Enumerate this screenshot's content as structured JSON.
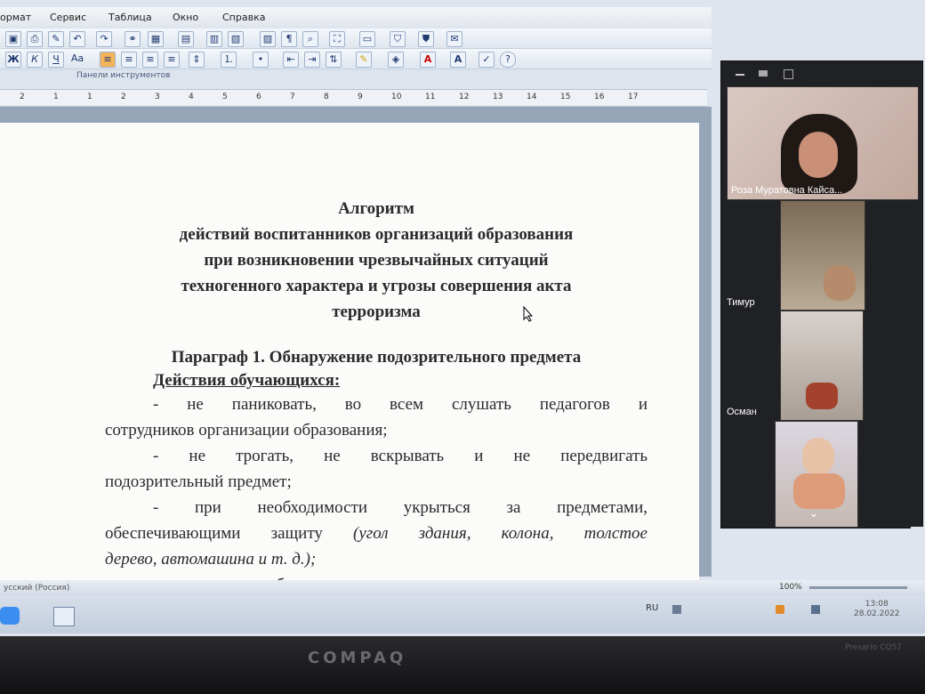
{
  "menu": {
    "items": [
      "ормат",
      "Сервис",
      "Таблица",
      "Окно",
      "Справка"
    ]
  },
  "toolbar": {
    "panel_label": "Панели инструментов",
    "font_size_hint": "Aa"
  },
  "ruler": {
    "numbers": [
      "2",
      "1",
      "1",
      "2",
      "3",
      "4",
      "5",
      "6",
      "7",
      "8",
      "9",
      "10",
      "11",
      "12",
      "13",
      "14",
      "15",
      "16",
      "17"
    ]
  },
  "document": {
    "title1": "Алгоритм",
    "title2": "действий воспитанников организаций образования",
    "title3": "при возникновении чрезвычайных ситуаций",
    "title4": "техногенного характера и угрозы совершения акта",
    "title5": "терроризма",
    "section": "Параграф 1. Обнаружение подозрительного предмета",
    "subheading": "Действия обучающихся:",
    "b1a": "- не паниковать, во всем слушать педагогов и",
    "b1b": "сотрудников организации образования;",
    "b2a": "- не трогать, не вскрывать и не передвигать",
    "b2b": "подозрительный предмет;",
    "b3a": "- при необходимости укрыться за предметами,",
    "b3b_plain": "обеспечивающими защиту ",
    "b3b_italic": "(угол здания, колона, толстое",
    "b3c": "дерево, автомашина и т. д.);",
    "b4a": "- покинуть объект, при невозможности - укрыться за"
  },
  "status": {
    "language": "усский (Россия)",
    "zoom": "100%"
  },
  "taskbar": {
    "lang": "RU",
    "time": "13:08",
    "date": "28.02.2022"
  },
  "bezel": {
    "brand": "COMPAQ",
    "model": "Presario CQ57"
  },
  "zoom": {
    "participants": [
      {
        "name": "Роза Муратовна Кайса..."
      },
      {
        "name": "Тимур"
      },
      {
        "name": "Осман"
      },
      {
        "name": ""
      }
    ]
  }
}
